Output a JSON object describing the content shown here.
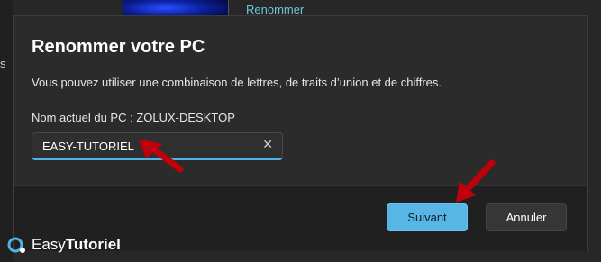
{
  "background": {
    "left_fragment": "s",
    "link_label": "Renommer"
  },
  "dialog": {
    "title": "Renommer votre PC",
    "description": "Vous pouvez utiliser une combinaison de lettres, de traits d’union et de chiffres.",
    "current_name_label": "Nom actuel du PC : ZOLUX-DESKTOP",
    "input_value": "EASY-TUTORIEL",
    "clear_icon": "close-icon",
    "next_label": "Suivant",
    "cancel_label": "Annuler"
  },
  "watermark": {
    "brand_prefix": "Easy",
    "brand_suffix": "Tutoriel"
  },
  "colors": {
    "accent": "#58b6e7",
    "annotation": "#c0000a"
  }
}
